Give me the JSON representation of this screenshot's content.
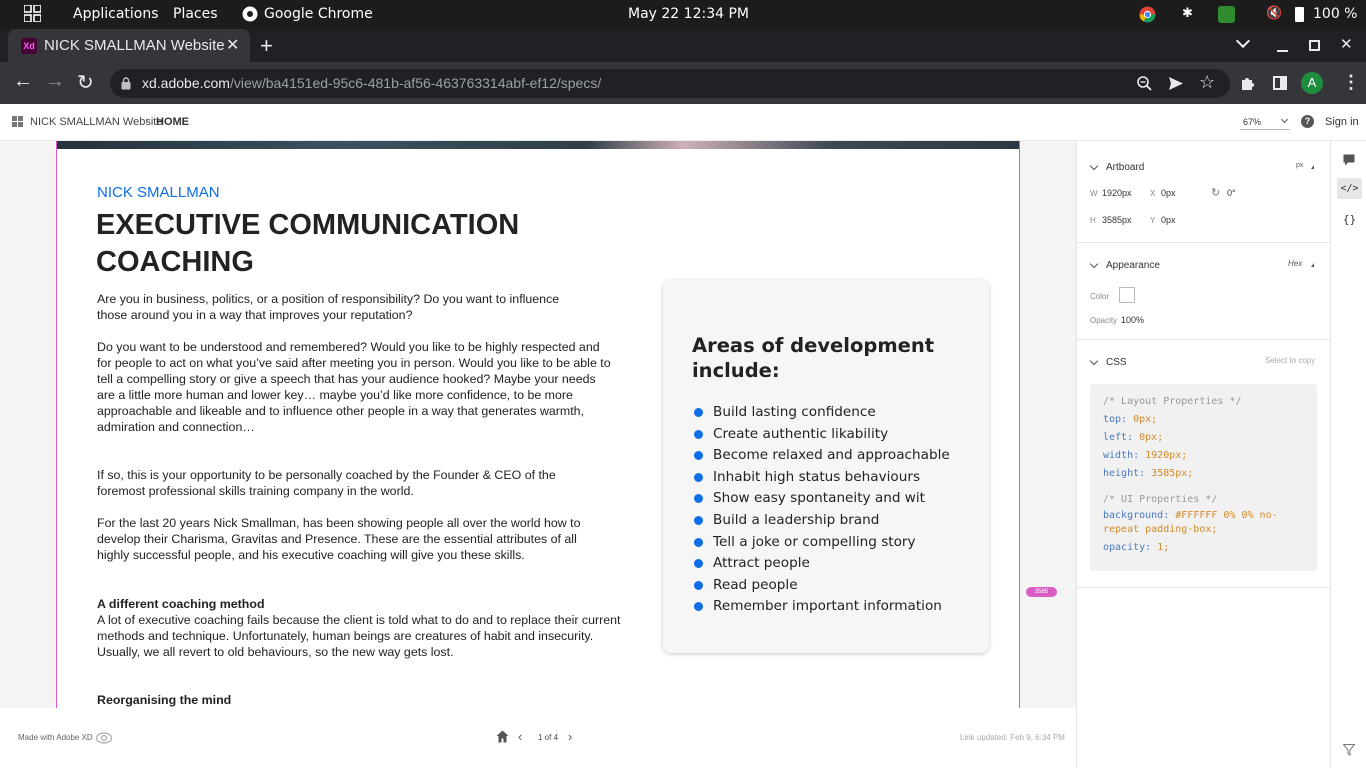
{
  "system_bar": {
    "applications": "Applications",
    "places": "Places",
    "active_app": "Google Chrome",
    "datetime": "May 22  12:34 PM",
    "battery": "100 %"
  },
  "browser": {
    "tab_title": "NICK SMALLMAN Website",
    "url_host": "xd.adobe.com",
    "url_path": "/view/ba4151ed-95c6-481b-af56-463763314abf-ef12/specs/",
    "profile_initial": "A"
  },
  "xd_header": {
    "project": "NICK SMALLMAN Website",
    "page": "HOME",
    "zoom": "67%",
    "sign_in": "Sign in"
  },
  "artboard": {
    "brand": "NICK SMALLMAN",
    "heading_line1": "EXECUTIVE COMMUNICATION",
    "heading_line2": "COACHING",
    "paragraphs": [
      "Are you in business, politics, or a position of responsibility? Do you want to influence those around you in a way that improves your reputation?",
      "Do you want to be understood and remembered? Would you like to be highly respected and for people to act on what you’ve said after meeting you in person. Would you like to be able to tell a compelling story or give a speech that has your audience hooked? Maybe your needs are a little more human and lower key… maybe you’d like more confidence, to be more approachable and likeable and to influence other people in a way that generates warmth, admiration and connection…",
      "If so, this is your opportunity to be personally coached by the Founder & CEO of the foremost professional skills training company in the world.",
      "For the last 20 years Nick Smallman, has been showing people all over the world how to develop their Charisma, Gravitas and Presence. These are the essential attributes of all highly successful people, and his executive coaching will give you these skills."
    ],
    "method_heading": "A different coaching method",
    "method_text": "A lot of executive coaching fails because the client is told what to do and to replace their current methods and technique. Unfortunately, human beings are creatures of habit and insecurity. Usually, we all revert to old behaviours, so the new way gets lost.",
    "reorg_heading": "Reorganising the mind",
    "areas_title": "Areas of development include:",
    "areas": [
      "Build lasting confidence",
      "Create authentic likability",
      "Become relaxed and approachable",
      "Inhabit high status behaviours",
      "Show easy spontaneity and wit",
      "Build a leadership brand",
      "Tell a joke or compelling story",
      "Attract people",
      "Read people",
      "Remember important information"
    ],
    "height_badge": "3585"
  },
  "footer": {
    "made_with": "Made with Adobe XD",
    "pager": "1 of 4",
    "link_updated": "Link updated: Feb 9, 6:34 PM"
  },
  "panel": {
    "artboard_title": "Artboard",
    "unit": "px",
    "w_label": "W",
    "w_value": "1920px",
    "x_label": "X",
    "x_value": "0px",
    "rotation": "0°",
    "h_label": "H",
    "h_value": "3585px",
    "y_label": "Y",
    "y_value": "0px",
    "appearance_title": "Appearance",
    "hex_label": "Hex",
    "color_label": "Color",
    "opacity_label": "Opacity",
    "opacity_value": "100%",
    "css_title": "CSS",
    "select_to_copy": "Select to copy",
    "css_layout_comment": "/* Layout Properties */",
    "css_top": "top: 0px;",
    "css_left": "left: 0px;",
    "css_width": "width: 1920px;",
    "css_height": "height: 3585px;",
    "css_ui_comment": "/* UI Properties */",
    "css_background_1": "background: #FFFFFF 0% 0% no-",
    "css_background_2": "repeat padding-box;",
    "css_opacity": "opacity: 1;"
  },
  "colors": {
    "accent_blue": "#0d6ee8",
    "artboard_border": "#d85ec6",
    "css_key": "#4a7ac0",
    "css_value": "#d38a2a"
  }
}
